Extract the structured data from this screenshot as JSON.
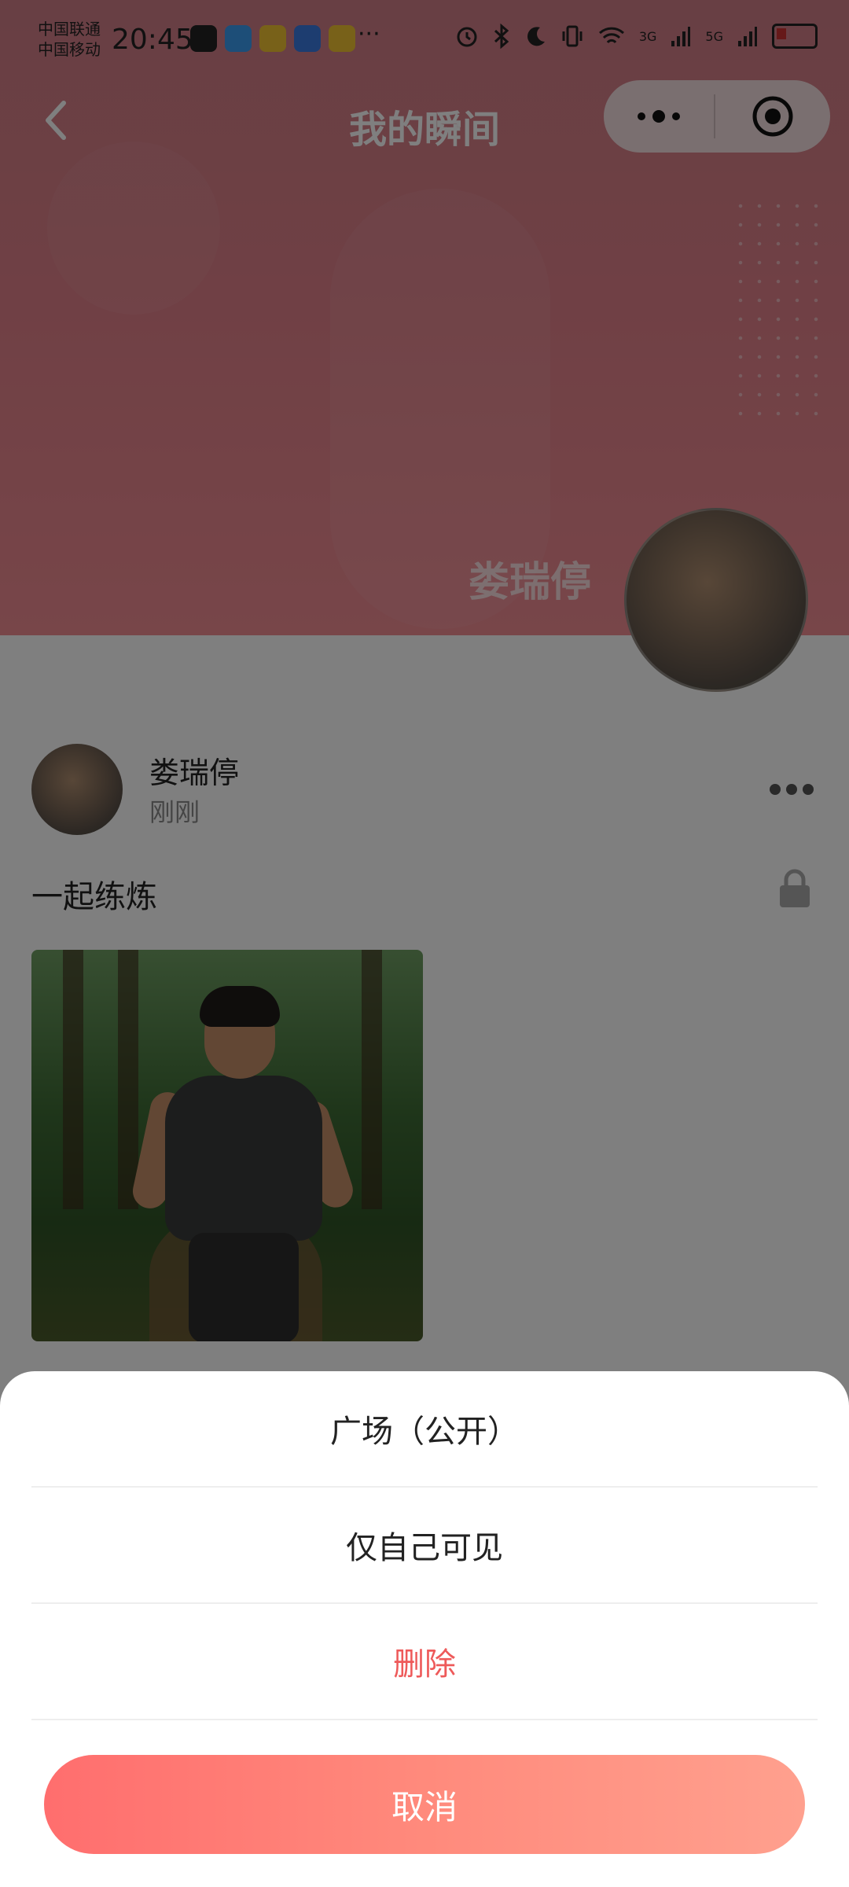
{
  "status_bar": {
    "carrier_1": "中国联通",
    "carrier_2": "中国移动",
    "time": "20:45",
    "ellipsis": "···",
    "network_1": "3G",
    "network_2": "5G"
  },
  "nav": {
    "title": "我的瞬间"
  },
  "profile": {
    "name": "娄瑞停"
  },
  "post": {
    "author": "娄瑞停",
    "time": "刚刚",
    "text": "一起练炼"
  },
  "action_sheet": {
    "options": [
      {
        "label": "广场（公开）"
      },
      {
        "label": "仅自己可见"
      },
      {
        "label": "删除",
        "color": "#ee5a5a"
      }
    ],
    "cancel_label": "取消"
  },
  "colors": {
    "banner": "#e0808a",
    "accent_start": "#ff6e6e",
    "accent_end": "#ffa08e",
    "delete": "#ee5a5a"
  }
}
